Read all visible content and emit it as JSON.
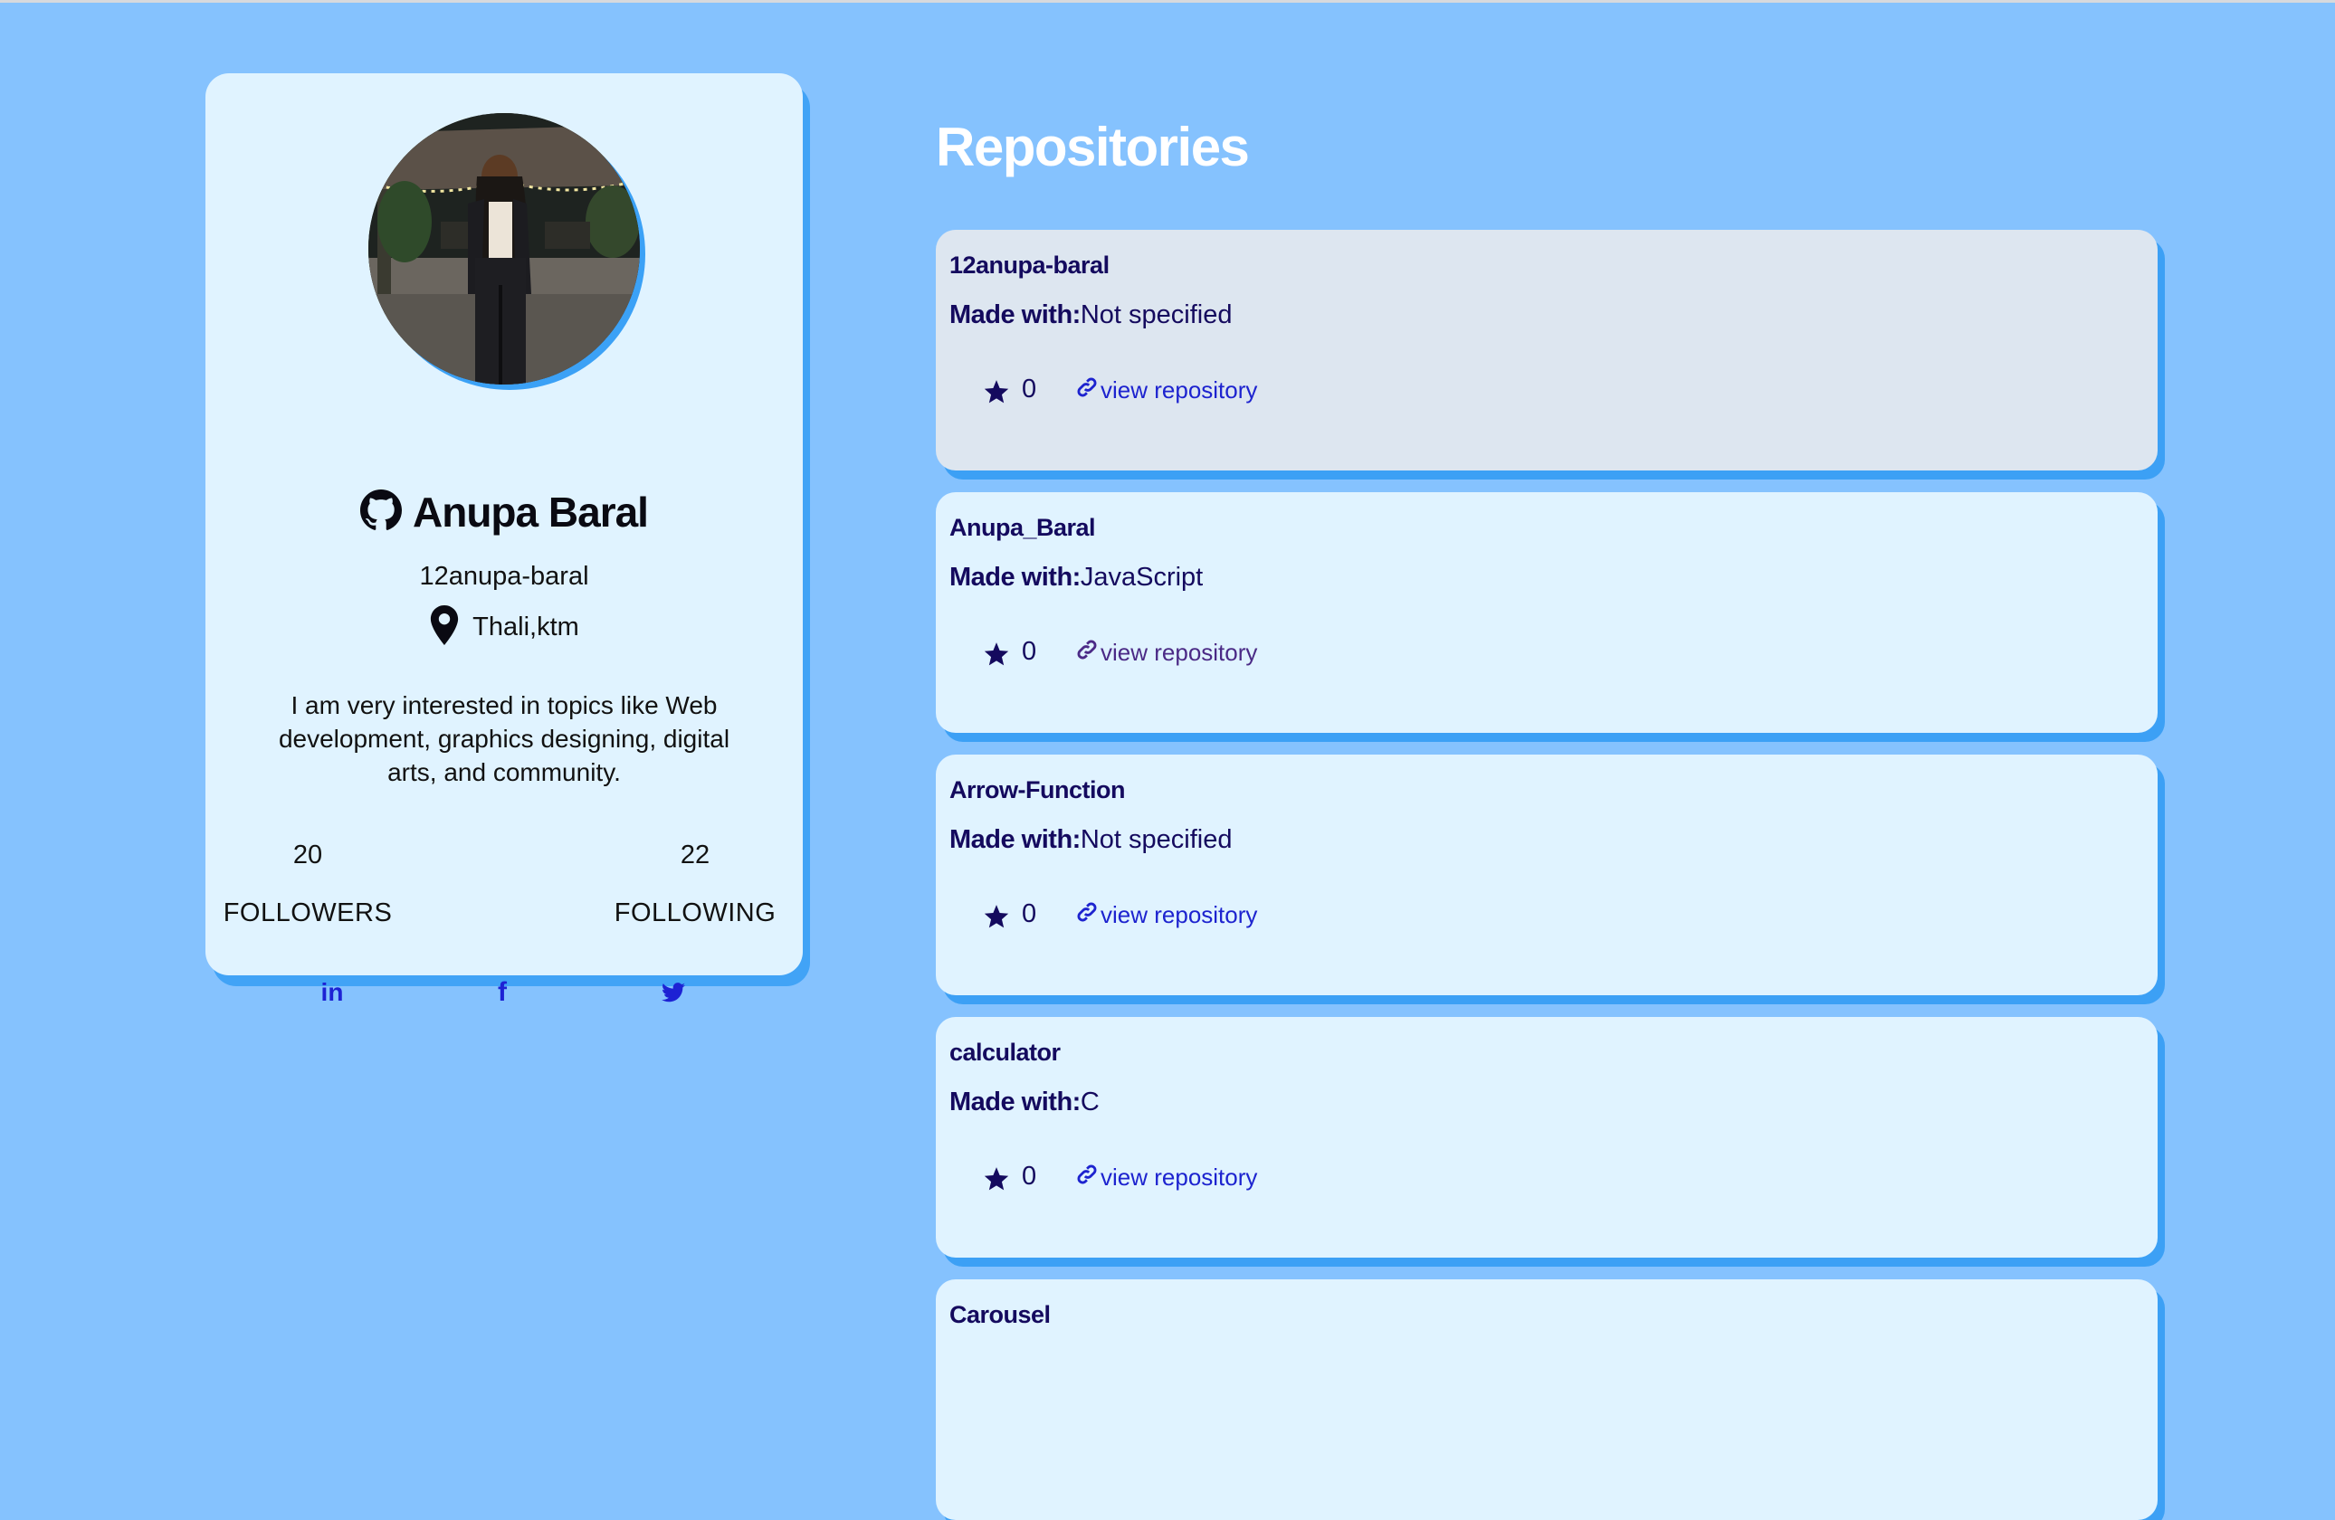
{
  "profile": {
    "name": "Anupa Baral",
    "username": "12anupa-baral",
    "location": "Thali,ktm",
    "bio": "I am very interested in topics like Web development, graphics designing, digital arts, and community.",
    "followers_count": "20",
    "followers_label": "FOLLOWERS",
    "following_count": "22",
    "following_label": "FOLLOWING",
    "social_links": [
      {
        "icon": "linkedin-icon",
        "glyph": "in"
      },
      {
        "icon": "facebook-icon",
        "glyph": "f"
      },
      {
        "icon": "twitter-icon",
        "glyph": "twitter-bird"
      }
    ]
  },
  "repositories": {
    "title": "Repositories",
    "made_with_label": "Made with:",
    "link_label": "view repository",
    "items": [
      {
        "name": "12anupa-baral",
        "language": "Not specified",
        "stars": "0",
        "state": "hovered"
      },
      {
        "name": "Anupa_Baral",
        "language": "JavaScript",
        "stars": "0",
        "state": "visited"
      },
      {
        "name": "Arrow-Function",
        "language": "Not specified",
        "stars": "0",
        "state": "normal"
      },
      {
        "name": "calculator",
        "language": "C",
        "stars": "0",
        "state": "normal"
      },
      {
        "name": "Carousel",
        "language": "",
        "stars": "",
        "state": "normal"
      }
    ]
  },
  "colors": {
    "page_background": "#85c2fe",
    "card_background": "#e0f3ff",
    "card_shadow": "#41a3f6",
    "repo_text": "#140a5e",
    "link": "#1d23cf"
  }
}
